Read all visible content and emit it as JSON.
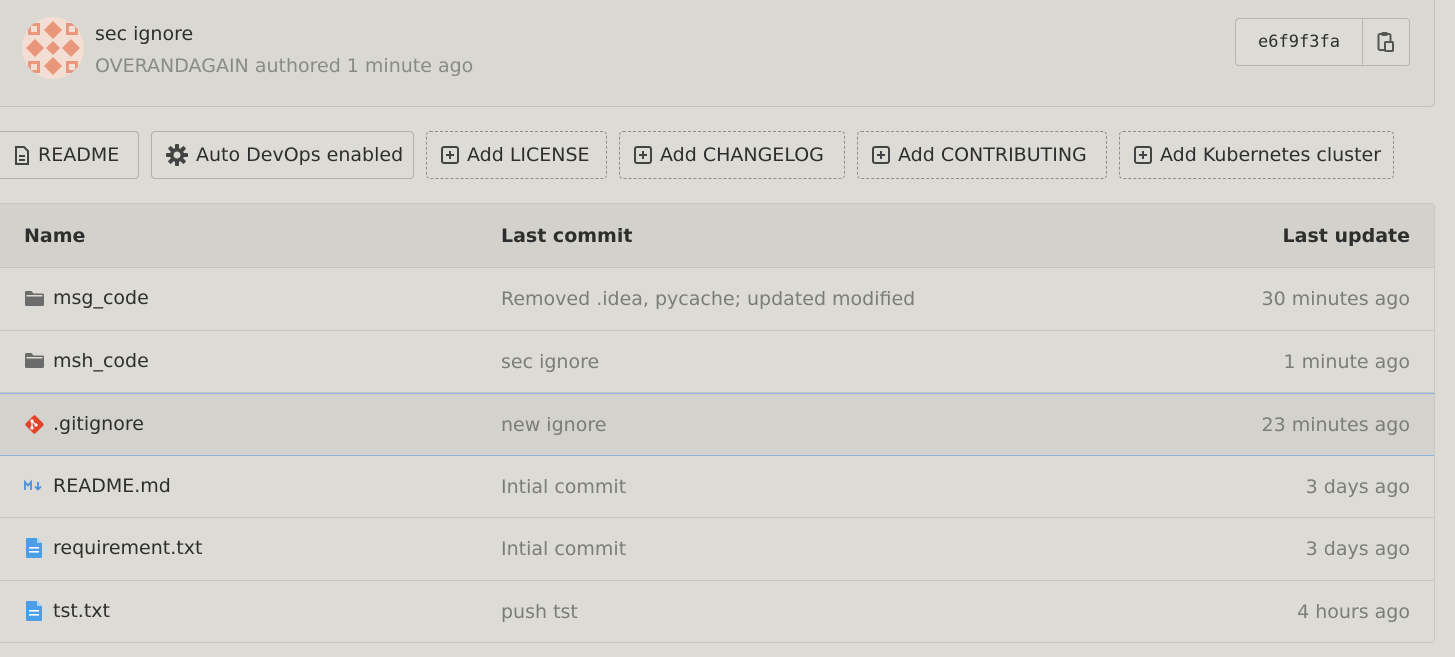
{
  "commit": {
    "title": "sec ignore",
    "author": "OVERANDAGAIN",
    "authored_text": "authored 1 minute ago",
    "sha": "e6f9f3fa",
    "avatar_color": "#e8977a"
  },
  "buttons": [
    {
      "label": "README",
      "style": "solid",
      "icon": "file-icon"
    },
    {
      "label": "Auto DevOps enabled",
      "style": "solid",
      "icon": "gear-icon"
    },
    {
      "label": "Add LICENSE",
      "style": "dashed",
      "icon": "plus-square-icon"
    },
    {
      "label": "Add CHANGELOG",
      "style": "dashed",
      "icon": "plus-square-icon"
    },
    {
      "label": "Add CONTRIBUTING",
      "style": "dashed",
      "icon": "plus-square-icon"
    },
    {
      "label": "Add Kubernetes cluster",
      "style": "dashed",
      "icon": "plus-square-icon"
    }
  ],
  "table": {
    "headers": {
      "name": "Name",
      "last_commit": "Last commit",
      "last_update": "Last update"
    },
    "rows": [
      {
        "name": "msg_code",
        "icon": "folder-icon",
        "commit": "Removed .idea, pycache; updated modified",
        "updated": "30 minutes ago"
      },
      {
        "name": "msh_code",
        "icon": "folder-icon",
        "commit": "sec ignore",
        "updated": "1 minute ago"
      },
      {
        "name": ".gitignore",
        "icon": "git-icon",
        "commit": "new ignore",
        "updated": "23 minutes ago"
      },
      {
        "name": "README.md",
        "icon": "markdown-icon",
        "commit": "Intial commit",
        "updated": "3 days ago"
      },
      {
        "name": "requirement.txt",
        "icon": "text-file-icon",
        "commit": "Intial commit",
        "updated": "3 days ago"
      },
      {
        "name": "tst.txt",
        "icon": "text-file-icon",
        "commit": "push tst",
        "updated": "4 hours ago"
      }
    ]
  },
  "colors": {
    "folder": "#6b6b6b",
    "git": "#e24329",
    "markdown": "#4a90d9",
    "text_file": "#4a9fe8"
  }
}
